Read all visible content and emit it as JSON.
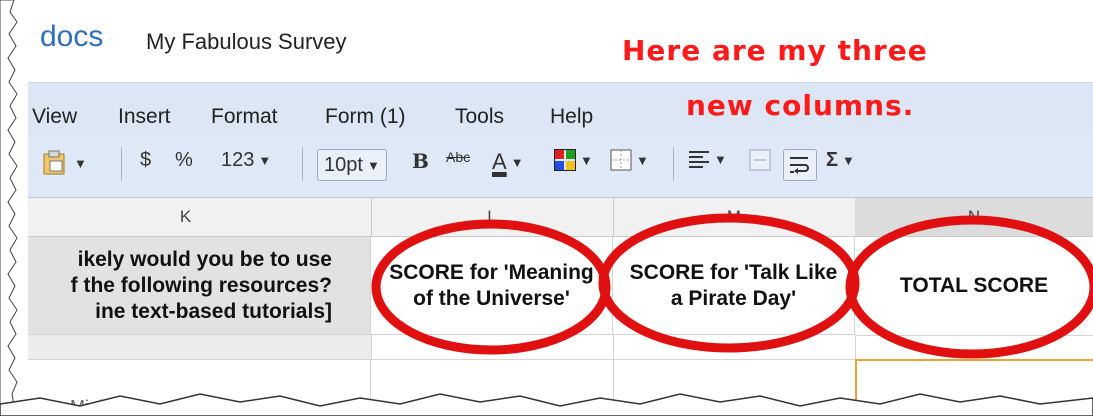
{
  "header": {
    "logo_text": "docs",
    "doc_title": "My Fabulous Survey"
  },
  "annotation": {
    "line1": "Here are my three",
    "line2": "new columns."
  },
  "menu": [
    "View",
    "Insert",
    "Format",
    "Form (1)",
    "Tools",
    "Help"
  ],
  "toolbar": {
    "currency": "$",
    "percent": "%",
    "number_format": "123",
    "font_size": "10pt",
    "bold": "B",
    "strike": "Abc",
    "text_color": "A",
    "sigma": "Σ"
  },
  "columns": [
    "K",
    "L",
    "M",
    "N"
  ],
  "cells": {
    "k_line1": "ikely would you be to use",
    "k_line2": "f the following resources?",
    "k_line3": "ine text-based tutorials]",
    "l": "SCORE for 'Meaning of the Universe'",
    "m": "SCORE for 'Talk Like a Pirate Day'",
    "n": "TOTAL SCORE",
    "k_row3": "Mightn't"
  },
  "colors": {
    "annotation": "#ff1a1a",
    "circle": "#e01010",
    "menubar": "#dce6f5",
    "logo": "#2f6fbe"
  },
  "icons": [
    "clipboard-icon",
    "bold-icon",
    "strikethrough-icon",
    "text-color-icon",
    "fill-color-icon",
    "borders-icon",
    "align-icon",
    "merge-icon",
    "wrap-icon",
    "sigma-icon"
  ]
}
